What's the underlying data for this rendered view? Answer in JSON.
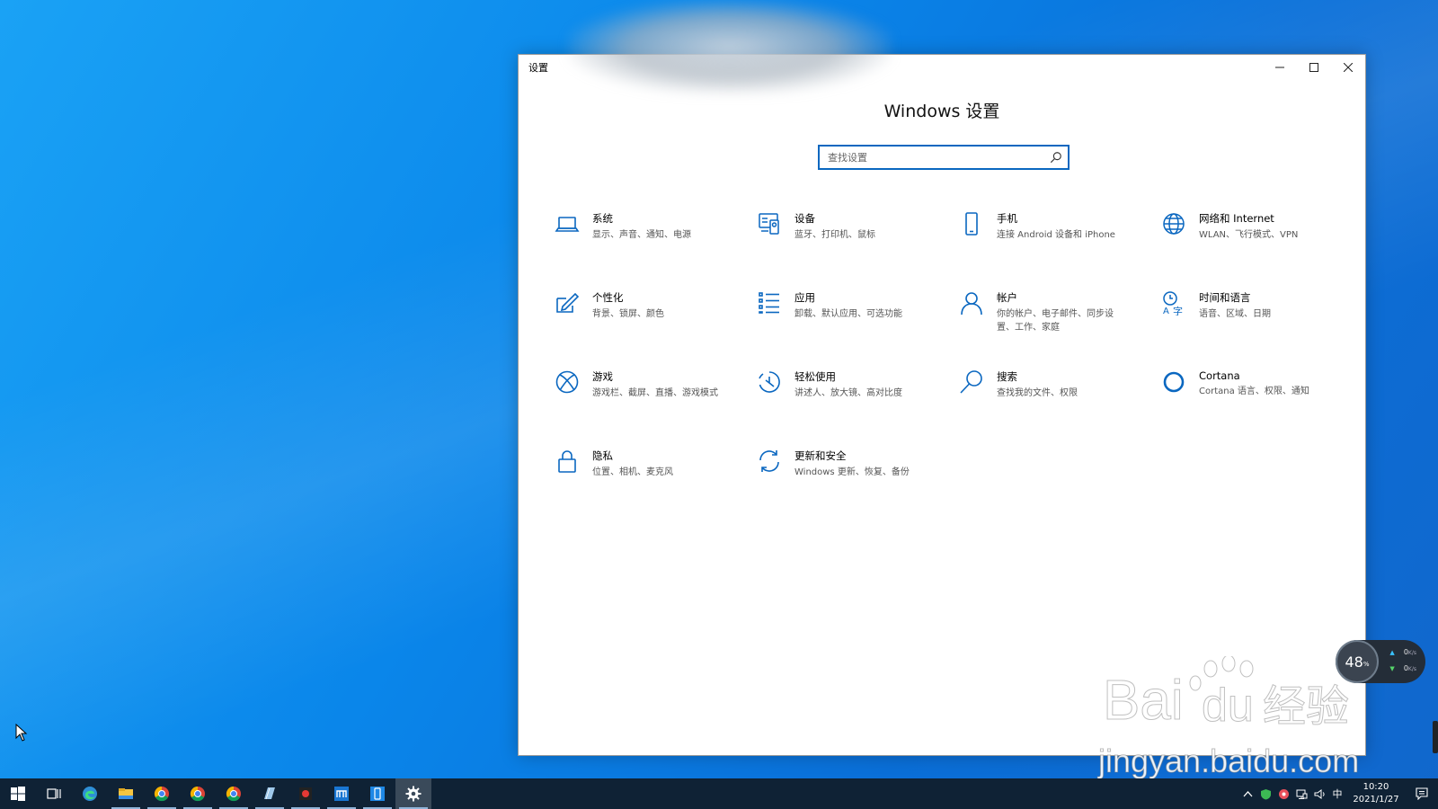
{
  "window": {
    "app_title": "设置",
    "page_title": "Windows 设置",
    "controls": {
      "minimize": "–",
      "maximize": "☐",
      "close": "✕"
    }
  },
  "search": {
    "placeholder": "查找设置",
    "value": ""
  },
  "categories": [
    {
      "name": "系统",
      "desc": "显示、声音、通知、电源",
      "icon": "laptop-icon"
    },
    {
      "name": "设备",
      "desc": "蓝牙、打印机、鼠标",
      "icon": "devices-icon"
    },
    {
      "name": "手机",
      "desc": "连接 Android 设备和 iPhone",
      "icon": "phone-icon"
    },
    {
      "name": "网络和 Internet",
      "desc": "WLAN、飞行模式、VPN",
      "icon": "globe-icon"
    },
    {
      "name": "个性化",
      "desc": "背景、锁屏、颜色",
      "icon": "personalization-icon"
    },
    {
      "name": "应用",
      "desc": "卸载、默认应用、可选功能",
      "icon": "apps-icon"
    },
    {
      "name": "帐户",
      "desc": "你的帐户、电子邮件、同步设置、工作、家庭",
      "icon": "account-icon"
    },
    {
      "name": "时间和语言",
      "desc": "语音、区域、日期",
      "icon": "time-language-icon"
    },
    {
      "name": "游戏",
      "desc": "游戏栏、截屏、直播、游戏模式",
      "icon": "xbox-icon"
    },
    {
      "name": "轻松使用",
      "desc": "讲述人、放大镜、高对比度",
      "icon": "ease-of-access-icon"
    },
    {
      "name": "搜索",
      "desc": "查找我的文件、权限",
      "icon": "search-icon"
    },
    {
      "name": "Cortana",
      "desc": "Cortana 语言、权限、通知",
      "icon": "cortana-icon"
    },
    {
      "name": "隐私",
      "desc": "位置、相机、麦克风",
      "icon": "lock-icon"
    },
    {
      "name": "更新和安全",
      "desc": "Windows 更新、恢复、备份",
      "icon": "update-icon"
    }
  ],
  "net_monitor": {
    "percent": "48",
    "percent_unit": "%",
    "upload": "0",
    "download": "0",
    "unit": "K/s"
  },
  "watermark": {
    "url": "jingyan.baidu.com",
    "logo_text": "Bai du 经验"
  },
  "taskbar": {
    "apps": [
      "windows-start-icon",
      "task-view-icon",
      "edge-icon",
      "file-explorer-icon",
      "chrome-icon",
      "chrome-icon",
      "chrome-icon",
      "notepad-icon",
      "recorder-icon",
      "store-icon",
      "phone-app-icon",
      "settings-gear-icon"
    ],
    "ime": "中",
    "time": "10:20",
    "date": "2021/1/27"
  },
  "colors": {
    "accent": "#0a67c0",
    "taskbar": "#0f2235",
    "desktop": "#0a86ea"
  }
}
